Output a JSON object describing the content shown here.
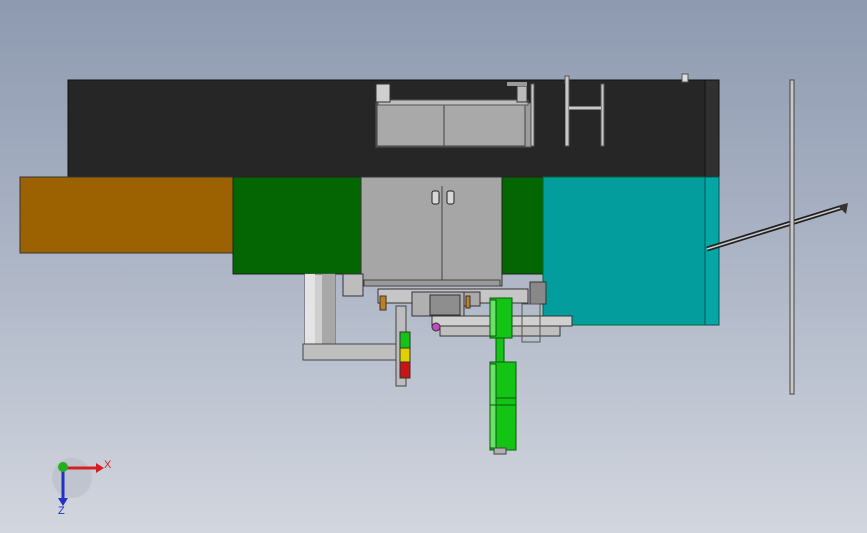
{
  "view": {
    "background": "gradient-blue-grey"
  },
  "triad": {
    "x_label": "X",
    "z_label": "Z",
    "x_color": "#d42020",
    "y_color": "#20b020",
    "z_color": "#2030c8"
  },
  "model": {
    "colors": {
      "top_frame": "#262626",
      "left_panel": "#9c6202",
      "green_panel": "#036603",
      "cyan_panel": "#049d9d",
      "cabinet": "#a6a6a6",
      "cylinder": "#14c414",
      "cylinder_dark": "#0a8a0a",
      "light_yellow": "#e0d000",
      "light_red": "#c81414",
      "light_green": "#14c414"
    }
  }
}
